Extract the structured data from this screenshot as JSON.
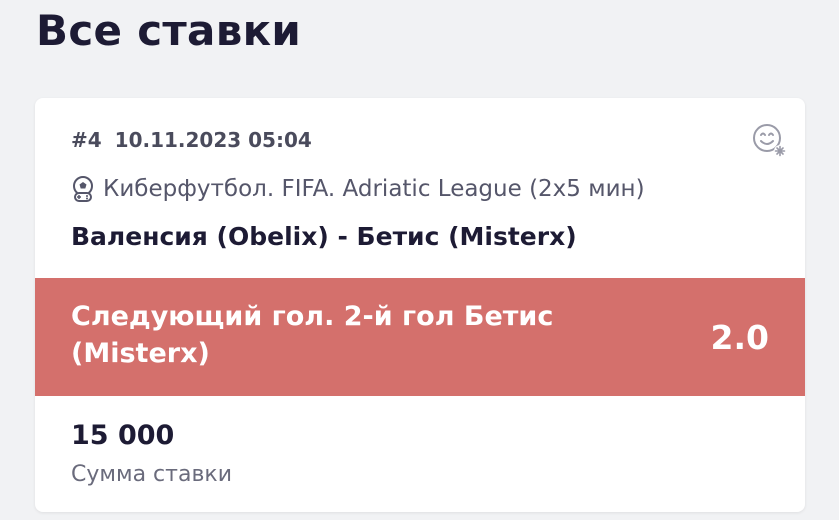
{
  "page": {
    "title": "Все ставки"
  },
  "bet": {
    "number": "#4",
    "datetime": "10.11.2023 05:04",
    "sport": "Киберфутбол. FIFA. Adriatic League (2x5 мин)",
    "match": "Валенсия (Obelix) - Бетис (Misterx)",
    "outcome": "Следующий гол. 2-й гол Бетис (Misterx)",
    "odds": "2.0",
    "stake_amount": "15 000",
    "stake_label": "Сумма ставки",
    "status_color": "#d4706c"
  },
  "icons": {
    "sport_icon": "esports-football-icon",
    "reaction_icon": "emoji-add-icon"
  }
}
